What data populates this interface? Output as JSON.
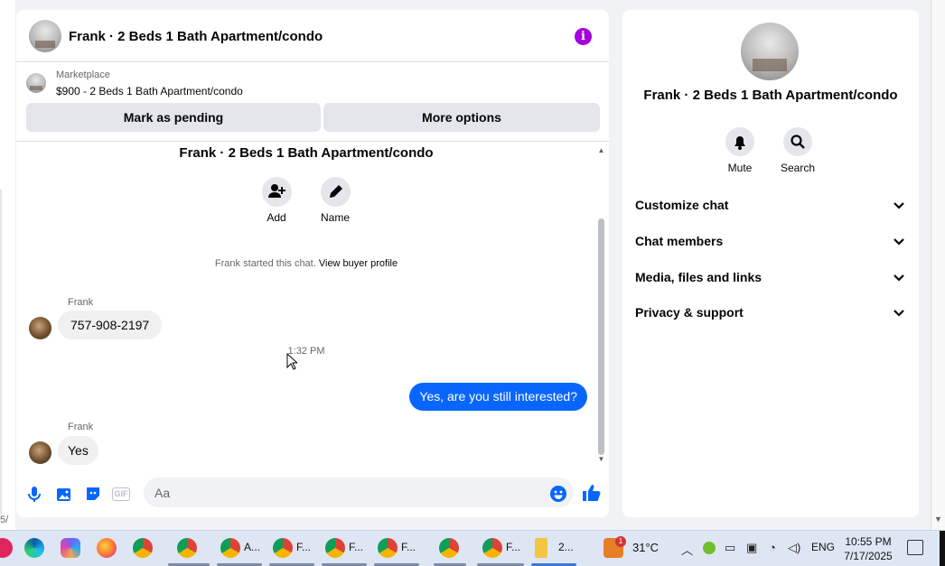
{
  "header": {
    "title": "Frank · 2 Beds 1 Bath Apartment/condo"
  },
  "listing": {
    "source": "Marketplace",
    "price_title": "$900 - 2 Beds 1 Bath Apartment/condo",
    "mark_pending": "Mark as pending",
    "more_options": "More options"
  },
  "conversation": {
    "title": "Frank · 2 Beds 1 Bath Apartment/condo",
    "actions": [
      {
        "label": "Add",
        "icon": "add-person-icon"
      },
      {
        "label": "Name",
        "icon": "pencil-icon"
      }
    ],
    "started_text": "Frank started this chat.",
    "view_buyer_profile": "View buyer profile",
    "messages": [
      {
        "sender": "Frank",
        "text": "757-908-2197",
        "direction": "in"
      },
      {
        "timestamp": "1:32 PM"
      },
      {
        "text": "Yes, are you still interested?",
        "direction": "out"
      },
      {
        "sender": "Frank",
        "text": "Yes",
        "direction": "in"
      }
    ]
  },
  "composer": {
    "placeholder": "Aa",
    "icons": [
      "microphone-icon",
      "photo-icon",
      "sticker-icon",
      "gif-icon",
      "emoji-icon",
      "like-icon"
    ],
    "gif_label": "GIF"
  },
  "info_panel": {
    "title": "Frank · 2 Beds 1 Bath Apartment/condo",
    "quick_actions": [
      {
        "label": "Mute",
        "icon": "bell-icon"
      },
      {
        "label": "Search",
        "icon": "search-icon"
      }
    ],
    "sections": [
      "Customize chat",
      "Chat members",
      "Media, files and links",
      "Privacy & support"
    ]
  },
  "taskbar": {
    "apps": [
      {
        "icon": "edge-icon"
      },
      {
        "icon": "copilot-icon"
      },
      {
        "icon": "firefox-icon"
      },
      {
        "icon": "chrome-icon"
      },
      {
        "icon": "chrome-profile-icon"
      },
      {
        "icon": "chrome-profile-icon",
        "label": "A..."
      },
      {
        "icon": "chrome-profile-icon",
        "label": "F..."
      },
      {
        "icon": "chrome-profile-icon",
        "label": "F..."
      },
      {
        "icon": "chrome-profile-icon",
        "label": "F..."
      },
      {
        "icon": "chrome-profile-icon"
      },
      {
        "icon": "chrome-profile-icon",
        "label": "F..."
      },
      {
        "icon": "folder-icon",
        "label": "2..."
      }
    ],
    "weather": {
      "temp": "31°C",
      "badge": "1"
    },
    "language": "ENG",
    "time": "10:55 PM",
    "date": "7/17/2025"
  },
  "left_fragment": "5/",
  "colors": {
    "accent": "#0866ff",
    "info_purple": "#a200e0",
    "bubble_in": "#f0f0f0",
    "panel_bg": "#f0f2f5"
  }
}
